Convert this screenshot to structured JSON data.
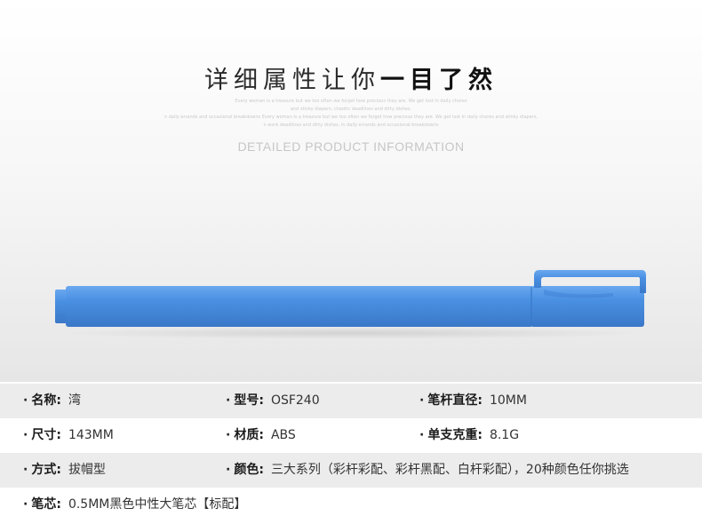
{
  "header": {
    "title_light": "详细属性让你",
    "title_bold": "一目了然",
    "fine_lines": [
      "Every woman is a treasure but we too often we forget how precious they are. We get lost in daily chores",
      "and stinky diapers, chaotic deadlines and dirty dishes.",
      "n daily errands and occasional breakdowns Every woman is a treasure but we too often we forget how precious they are. We get lost in daily chores and stinky diapers,",
      "n work deadlines and dirty dishes, in daily errands and occasional breakdowns"
    ],
    "subtitle": "DETAILED PRODUCT INFORMATION"
  },
  "product": {
    "pen_color": "#4a90e2",
    "pen_highlight": "#6aa8f0",
    "pen_shadow": "#3a78c8"
  },
  "specs": [
    {
      "shade": true,
      "items": [
        {
          "label": "名称:",
          "value": "湾"
        },
        {
          "label": "型号:",
          "value": "OSF240"
        },
        {
          "label": "笔杆直径:",
          "value": "10MM"
        }
      ]
    },
    {
      "shade": false,
      "items": [
        {
          "label": "尺寸:",
          "value": "143MM"
        },
        {
          "label": "材质:",
          "value": "ABS"
        },
        {
          "label": "单支克重:",
          "value": "8.1G"
        }
      ]
    },
    {
      "shade": true,
      "items": [
        {
          "label": "方式:",
          "value": "拔帽型"
        },
        {
          "label": "颜色:",
          "value": "三大系列（彩杆彩配、彩杆黑配、白杆彩配），20种颜色任你挑选"
        }
      ]
    },
    {
      "shade": false,
      "items": [
        {
          "label": "笔芯:",
          "value": "0.5MM黑色中性大笔芯【标配】"
        }
      ]
    }
  ],
  "bullet": "·"
}
